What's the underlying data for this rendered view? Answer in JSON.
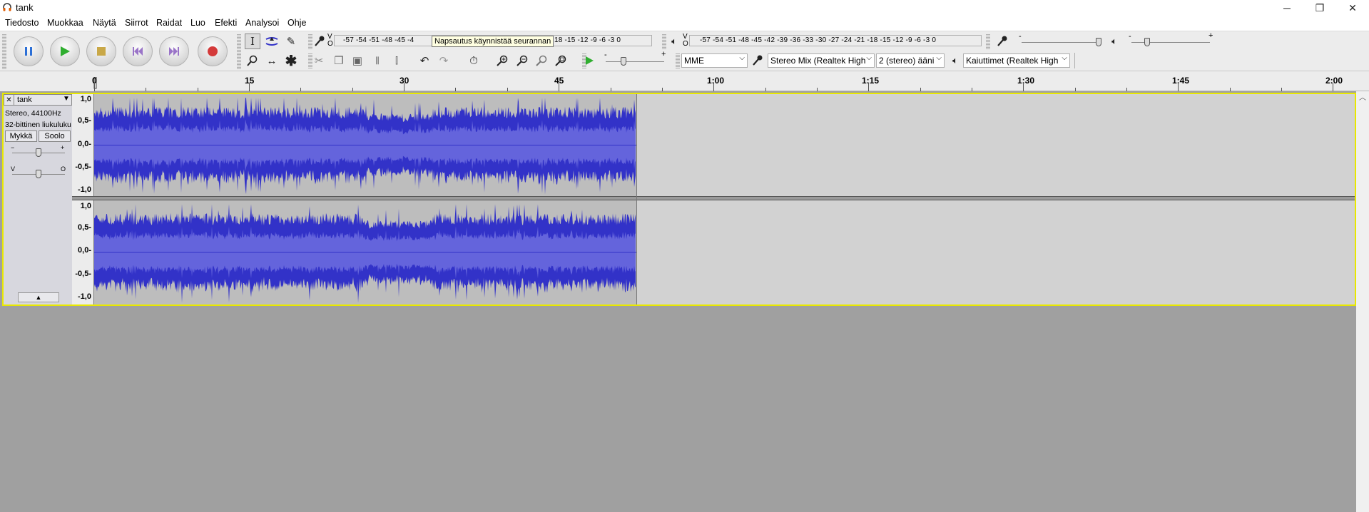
{
  "window": {
    "title": "tank",
    "minimize": "─",
    "restore": "❐",
    "close": "✕"
  },
  "menu": [
    "Tiedosto",
    "Muokkaa",
    "Näytä",
    "Siirrot",
    "Raidat",
    "Luo",
    "Efekti",
    "Analysoi",
    "Ohje"
  ],
  "meters": {
    "record_scale": "-57 -54 -51 -48 -45 -4",
    "record_scale_tail": "18 -15 -12  -9  -6  -3  0",
    "record_lr": "V\nO",
    "tooltip": "Napsautus käynnistää seurannan",
    "play_scale": "-57 -54 -51 -48 -45 -42 -39 -36 -33 -30 -27 -24 -21 -18 -15 -12  -9  -6  -3  0",
    "play_lr": "V\nO"
  },
  "mixer": {
    "minus": "-",
    "plus": "+"
  },
  "play_speed": {
    "minus": "-",
    "plus": "+"
  },
  "devices": {
    "host": "MME",
    "recording_device": "Stereo Mix (Realtek High",
    "channels": "2 (stereo) ääni",
    "playback_device": "Kaiuttimet (Realtek High"
  },
  "ruler": {
    "labels": [
      "0",
      "15",
      "30",
      "45",
      "1:00",
      "1:15",
      "1:30",
      "1:45",
      "2:00"
    ]
  },
  "track": {
    "name": "tank",
    "info_format": "Stereo, 44100Hz",
    "info_bits": "32-bittinen liukuluku",
    "mute": "Mykkä",
    "solo": "Soolo",
    "gain_minus": "−",
    "gain_plus": "+",
    "pan_left": "V",
    "pan_right": "O",
    "collapse": "▲"
  },
  "vruler": [
    "1,0",
    "0,5-",
    "0,0-",
    "-0,5-",
    "-1,0"
  ],
  "colors": {
    "waveform": "#3232c8",
    "rms": "#6464dc",
    "selection_border": "#e8e800"
  }
}
